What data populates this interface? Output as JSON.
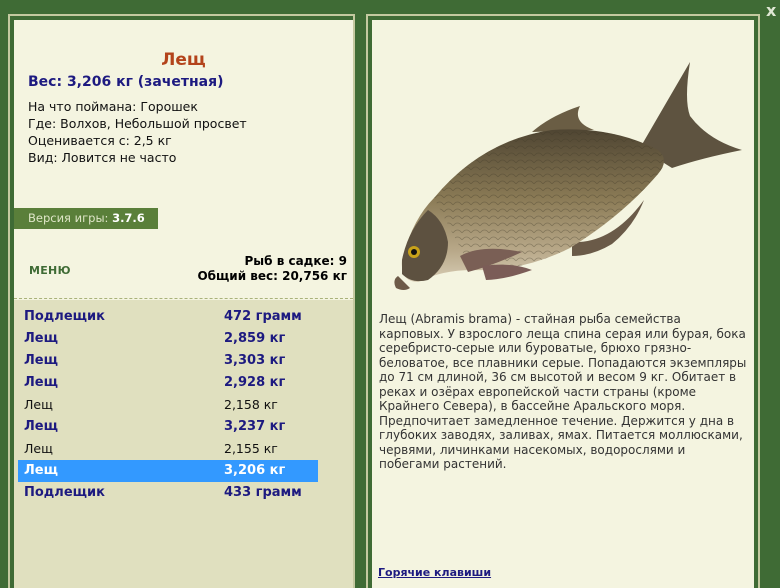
{
  "window": {
    "close_label": "x"
  },
  "fish": {
    "title": "Лещ",
    "weight_line": "Вес: 3,206 кг (зачетная)",
    "info": [
      "На что поймана: Горошек",
      "Где: Волхов, Небольшой просвет",
      "Оценивается с: 2,5 кг",
      "Вид: Ловится не часто"
    ]
  },
  "version": {
    "label": "Версия игры:",
    "value": "3.7.6"
  },
  "menu_label": "МЕНЮ",
  "stats": {
    "fish_count": "Рыб в садке: 9",
    "total_weight": "Общий вес: 20,756 кг"
  },
  "catches": [
    {
      "name": "Подлещик",
      "weight": "472 грамм",
      "trophy": true
    },
    {
      "name": "Лещ",
      "weight": "2,859 кг",
      "trophy": true
    },
    {
      "name": "Лещ",
      "weight": "3,303 кг",
      "trophy": true
    },
    {
      "name": "Лещ",
      "weight": "2,928 кг",
      "trophy": true
    },
    {
      "name": "Лещ",
      "weight": "2,158 кг",
      "trophy": false
    },
    {
      "name": "Лещ",
      "weight": "3,237 кг",
      "trophy": true
    },
    {
      "name": "Лещ",
      "weight": "2,155 кг",
      "trophy": false
    },
    {
      "name": "Лещ",
      "weight": "3,206 кг",
      "trophy": true,
      "selected": true
    },
    {
      "name": "Подлещик",
      "weight": "433 грамм",
      "trophy": true
    }
  ],
  "description": "Лещ (Abramis brama) - стайная рыба семейства карповых. У взрослого леща спина серая или бурая, бока серебристо-серые или буроватые, брюхо грязно-беловатое, все плавники серые. Попадаются экземпляры до 71 см длиной, 36 см высотой и весом 9 кг. Обитает в реках и озёрах европейской части страны (кроме Крайнего Севера), в бассейне Аральского моря. Предпочитает замедленное течение. Держится у дна в глубоких заводях, заливах, ямах. Питается моллюсками, червями, личинками насекомых, водорослями и побегами растений.",
  "hotkeys_label": "Горячие клавиши",
  "colors": {
    "background": "#3f6b35",
    "panel": "#f4f4e0",
    "list": "#e0e0bf",
    "title": "#b3431b",
    "trophy": "#1d1a80",
    "selected": "#3399ff"
  },
  "icons": {
    "close": "close-icon",
    "fish_image": "bream-fish-image"
  }
}
